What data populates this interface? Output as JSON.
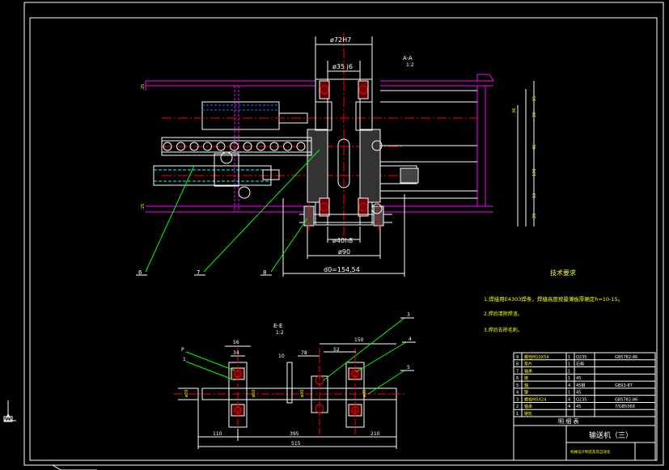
{
  "section_aa": {
    "title": "A-A",
    "scale": "1:2"
  },
  "section_ee": {
    "title": "E-E",
    "scale": "1:2"
  },
  "dims_top": {
    "d72": "ø72H7",
    "d35": "ø35 j6",
    "d40": "ø40h8",
    "d90": "ø90",
    "d0": "d0=154,54"
  },
  "callouts_top": [
    "6",
    "7",
    "8"
  ],
  "callouts_bottom": [
    "1",
    "2",
    "3",
    "4",
    "5"
  ],
  "tech_req": {
    "title": "技术要求",
    "items": [
      "1.焊接用E4303焊条，焊缝高度按最薄板厚确定h=10-15。",
      "2.焊后清除焊渣。",
      "3.焊后去除毛刺。"
    ]
  },
  "dims_bottom": {
    "d56": "56",
    "d34": "34",
    "d78": "78",
    "d10": "10",
    "d150": "150",
    "d52": "52",
    "d110": "110",
    "d395": "395",
    "d515": "515",
    "d210": "210"
  },
  "bom": {
    "rows": [
      {
        "no": "9",
        "name": "螺栓M10X54",
        "qty": "1",
        "mat": "Q235",
        "std": "GB5782-86"
      },
      {
        "no": "8",
        "name": "垫片",
        "qty": "1",
        "mat": "石棉",
        "std": ""
      },
      {
        "no": "7",
        "name": "轴承",
        "qty": "1",
        "mat": "",
        "std": ""
      },
      {
        "no": "6",
        "name": "链",
        "qty": "1",
        "mat": "45",
        "std": ""
      },
      {
        "no": "5",
        "name": "轴",
        "qty": "4",
        "mat": "45钢",
        "std": "GB93-87"
      },
      {
        "no": "4",
        "name": "键",
        "qty": "1",
        "mat": "45",
        "std": ""
      },
      {
        "no": "3",
        "name": "螺栓M5X24",
        "qty": "4",
        "mat": "Q235",
        "std": "GB5782-86"
      },
      {
        "no": "2",
        "name": "轴承",
        "qty": "4",
        "mat": "45",
        "std": "7/GB5068"
      },
      {
        "no": "1",
        "name": "链轮",
        "qty": "",
        "mat": "",
        "std": ""
      }
    ],
    "footer": "明 细 表",
    "drawing_title": "输送机（三）",
    "school": "机械设计制造及其自动化"
  }
}
